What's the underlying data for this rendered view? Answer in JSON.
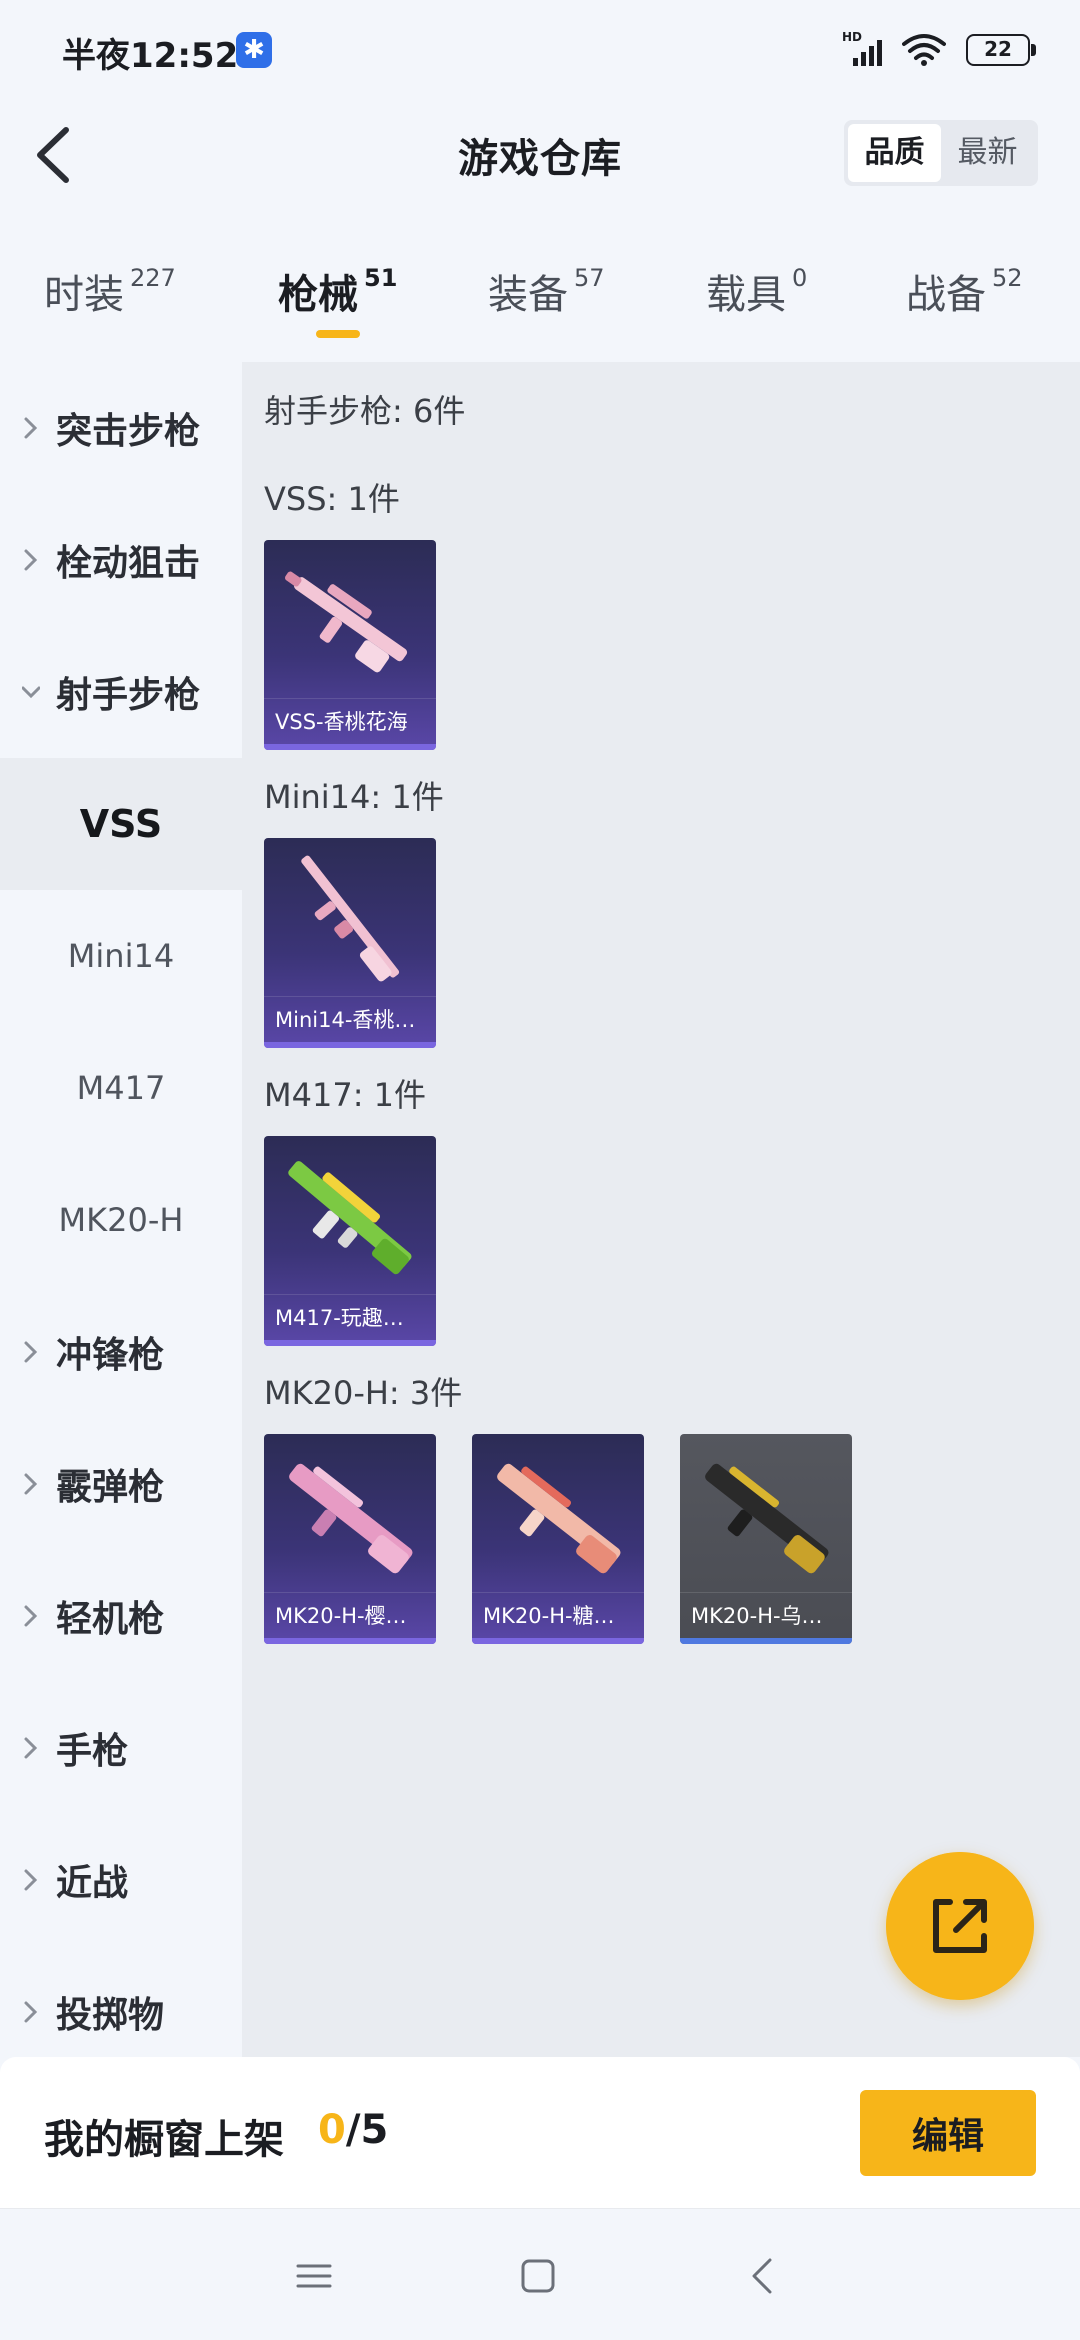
{
  "status_bar": {
    "time": "半夜12:52",
    "app_icon_glyph": "✱",
    "network_label": "HD",
    "battery": "22"
  },
  "header": {
    "title": "游戏仓库",
    "sort_options": [
      "品质",
      "最新"
    ],
    "sort_active": "品质"
  },
  "tabs": [
    {
      "label": "时装",
      "count": "227"
    },
    {
      "label": "枪械",
      "count": "51",
      "active": true
    },
    {
      "label": "装备",
      "count": "57"
    },
    {
      "label": "载具",
      "count": "0"
    },
    {
      "label": "战备",
      "count": "52"
    }
  ],
  "sidebar": {
    "categories": [
      "突击步枪",
      "栓动狙击",
      "射手步枪",
      "冲锋枪",
      "霰弹枪",
      "轻机枪",
      "手枪",
      "近战",
      "投掷物"
    ],
    "expanded_category": "射手步枪",
    "subitems": [
      "VSS",
      "Mini14",
      "M417",
      "MK20-H"
    ],
    "active_subitem": "VSS"
  },
  "main": {
    "summary": "射手步枪: 6件",
    "groups": [
      {
        "heading": "VSS: 1件",
        "items": [
          {
            "name": "VSS-香桃花海",
            "skin": "pink"
          }
        ]
      },
      {
        "heading": "Mini14: 1件",
        "items": [
          {
            "name": "Mini14-香桃…",
            "skin": "pink"
          }
        ]
      },
      {
        "heading": "M417: 1件",
        "items": [
          {
            "name": "M417-玩趣…",
            "skin": "green"
          }
        ]
      },
      {
        "heading": "MK20-H: 3件",
        "items": [
          {
            "name": "MK20-H-樱…",
            "skin": "pink"
          },
          {
            "name": "MK20-H-糖…",
            "skin": "coral"
          },
          {
            "name": "MK20-H-乌…",
            "skin": "gold"
          }
        ]
      }
    ]
  },
  "showcase": {
    "label": "我的橱窗上架",
    "current": "0",
    "separator_total": "/5",
    "edit_label": "编辑"
  },
  "colors": {
    "accent": "#f7b519",
    "card_purple": "#3b3477",
    "card_grey": "#4a4c53"
  }
}
